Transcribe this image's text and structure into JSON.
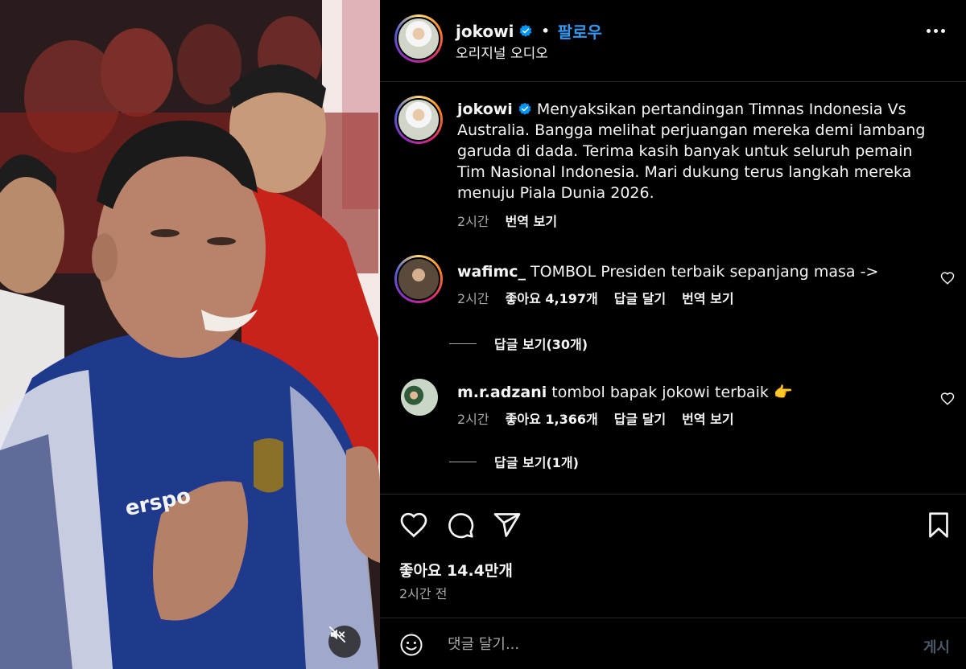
{
  "post": {
    "username": "jokowi",
    "follow_label": "팔로우",
    "separator": "•",
    "audio": "오리지널 오디오"
  },
  "media": {
    "shirt_brand": "erspo"
  },
  "caption": {
    "username": "jokowi",
    "text": "Menyaksikan pertandingan Timnas Indonesia Vs Australia. Bangga melihat perjuangan mereka demi lambang garuda di dada. Terima kasih banyak untuk seluruh pemain Tim Nasional Indonesia. Mari dukung terus langkah mereka menuju Piala Dunia 2026.",
    "time": "2시간",
    "translate": "번역 보기"
  },
  "comments": [
    {
      "username": "wafimc_",
      "text": "TOMBOL Presiden terbaik sepanjang masa ->",
      "time": "2시간",
      "likes": "좋아요 4,197개",
      "reply": "답글 달기",
      "translate": "번역 보기",
      "view_replies": "답글 보기(30개)"
    },
    {
      "username": "m.r.adzani",
      "text": "tombol bapak jokowi terbaik 👉",
      "time": "2시간",
      "likes": "좋아요 1,366개",
      "reply": "답글 달기",
      "translate": "번역 보기",
      "view_replies": "답글 보기(1개)"
    }
  ],
  "actions": {
    "likes": "좋아요 14.4만개",
    "time": "2시간 전"
  },
  "composer": {
    "placeholder": "댓글 달기...",
    "post_label": "게시"
  },
  "colors": {
    "accent": "#3797f0",
    "background": "#000000",
    "muted_text": "#a8a8a8"
  },
  "icons": [
    "verified-badge-icon",
    "more-options-icon",
    "heart-icon",
    "comment-icon",
    "share-icon",
    "bookmark-icon",
    "emoji-icon",
    "mute-icon"
  ]
}
